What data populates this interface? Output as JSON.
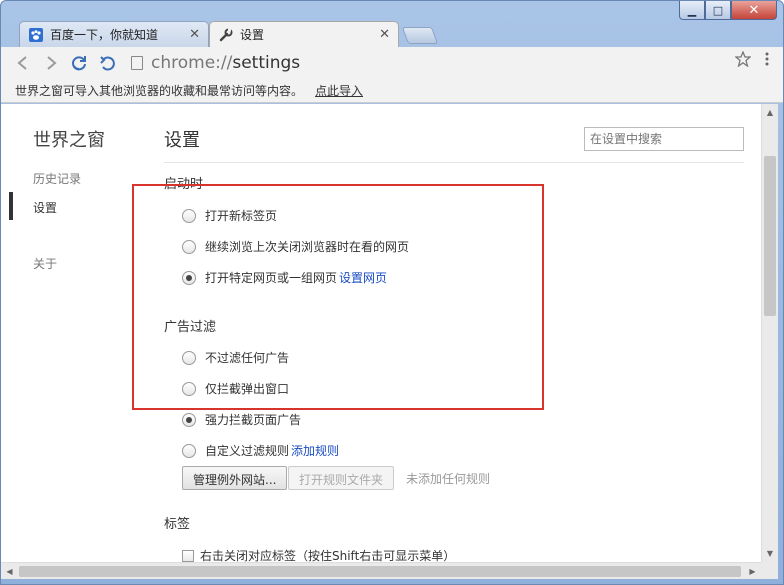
{
  "window": {
    "caption_min": "▁",
    "caption_max": "□",
    "caption_close": "✕"
  },
  "tabs": [
    {
      "title": "百度一下，你就知道",
      "close": "✕"
    },
    {
      "title": "设置",
      "close": "✕"
    }
  ],
  "toolbar": {
    "url_scheme": "chrome://",
    "url_path": "settings"
  },
  "infobar": {
    "text": "世界之窗可导入其他浏览器的收藏和最常访问等内容。",
    "link": "点此导入"
  },
  "sidebar": {
    "brand": "世界之窗",
    "items": [
      {
        "label": "历史记录"
      },
      {
        "label": "设置"
      },
      {
        "label": "关于"
      }
    ]
  },
  "main": {
    "title": "设置",
    "search_placeholder": "在设置中搜索",
    "startup": {
      "title": "启动时",
      "options": [
        {
          "label": "打开新标签页",
          "checked": false
        },
        {
          "label": "继续浏览上次关闭浏览器时在看的网页",
          "checked": false
        },
        {
          "label": "打开特定网页或一组网页",
          "checked": true,
          "link": "设置网页"
        }
      ]
    },
    "adfilter": {
      "title": "广告过滤",
      "options": [
        {
          "label": "不过滤任何广告",
          "checked": false
        },
        {
          "label": "仅拦截弹出窗口",
          "checked": false
        },
        {
          "label": "强力拦截页面广告",
          "checked": true
        },
        {
          "label": "自定义过滤规则",
          "checked": false,
          "link": "添加规则"
        }
      ],
      "manage_button": "管理例外网站...",
      "open_folder_button": "打开规则文件夹",
      "no_rules": "未添加任何规则"
    },
    "tabs_section": {
      "title": "标签",
      "checkbox_label": "右击关闭对应标签（按住Shift右击可显示菜单）"
    }
  },
  "colors": {
    "highlight": "#d9342b",
    "link": "#1a4cc4"
  }
}
